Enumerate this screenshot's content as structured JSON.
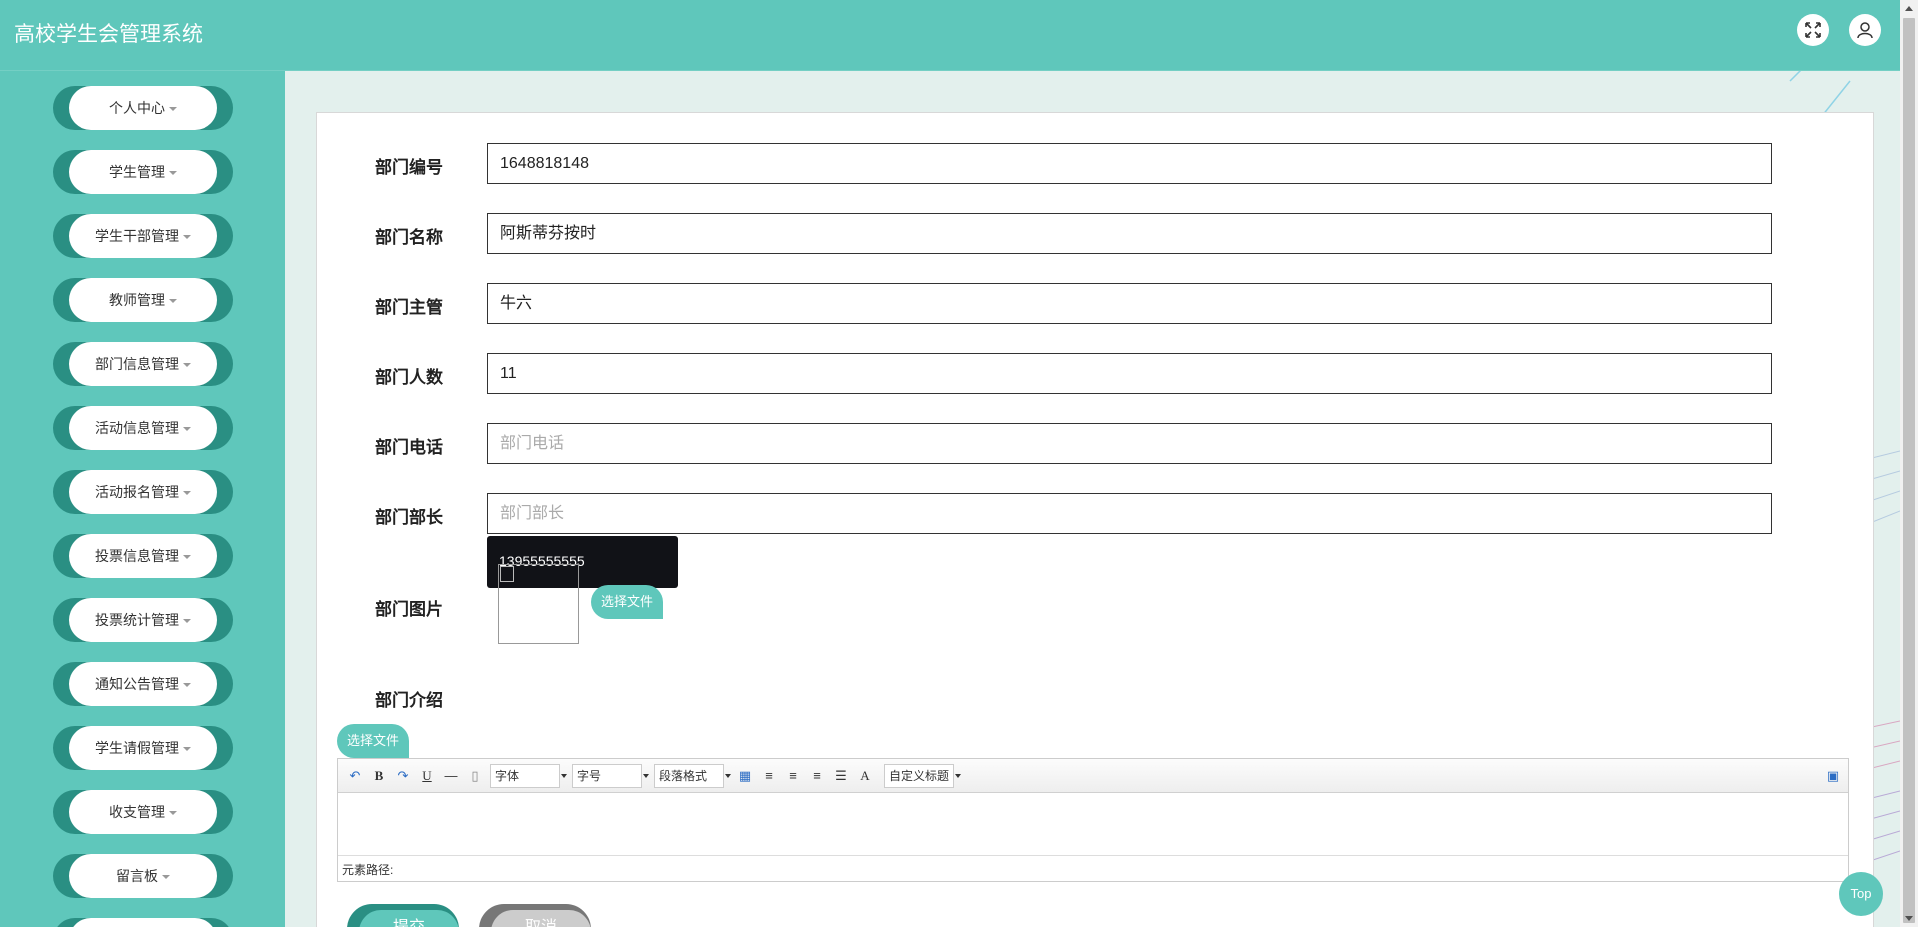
{
  "header": {
    "title": "高校学生会管理系统",
    "fullscreen_icon": "fullscreen-icon",
    "user_icon": "user-icon"
  },
  "sidebar": {
    "items": [
      {
        "label": "个人中心"
      },
      {
        "label": "学生管理"
      },
      {
        "label": "学生干部管理"
      },
      {
        "label": "教师管理"
      },
      {
        "label": "部门信息管理"
      },
      {
        "label": "活动信息管理"
      },
      {
        "label": "活动报名管理"
      },
      {
        "label": "投票信息管理"
      },
      {
        "label": "投票统计管理"
      },
      {
        "label": "通知公告管理"
      },
      {
        "label": "学生请假管理"
      },
      {
        "label": "收支管理"
      },
      {
        "label": "留言板"
      }
    ]
  },
  "form": {
    "dept_no": {
      "label": "部门编号",
      "value": "1648818148"
    },
    "dept_name": {
      "label": "部门名称",
      "value": "阿斯蒂芬按时"
    },
    "dept_head": {
      "label": "部门主管",
      "value": "牛六"
    },
    "dept_count": {
      "label": "部门人数",
      "value": "11"
    },
    "dept_phone": {
      "label": "部门电话",
      "placeholder": "部门电话"
    },
    "dept_minister": {
      "label": "部门部长",
      "placeholder": "部门部长"
    },
    "autocomplete_option": "13955555555",
    "dept_image": {
      "label": "部门图片",
      "button": "选择文件"
    },
    "dept_intro": {
      "label": "部门介绍",
      "button": "选择文件"
    }
  },
  "editor": {
    "font_select": "字体",
    "size_select": "字号",
    "paragraph_select": "段落格式",
    "custom_title_select": "自定义标题",
    "path_label": "元素路径:",
    "bold": "B",
    "underline": "U",
    "font_color": "A"
  },
  "actions": {
    "submit": "提交",
    "cancel": "取消",
    "top": "Top"
  },
  "colors": {
    "primary": "#5fc7bb",
    "primary_dark": "#2a8f83",
    "background": "#e3f0ed"
  }
}
